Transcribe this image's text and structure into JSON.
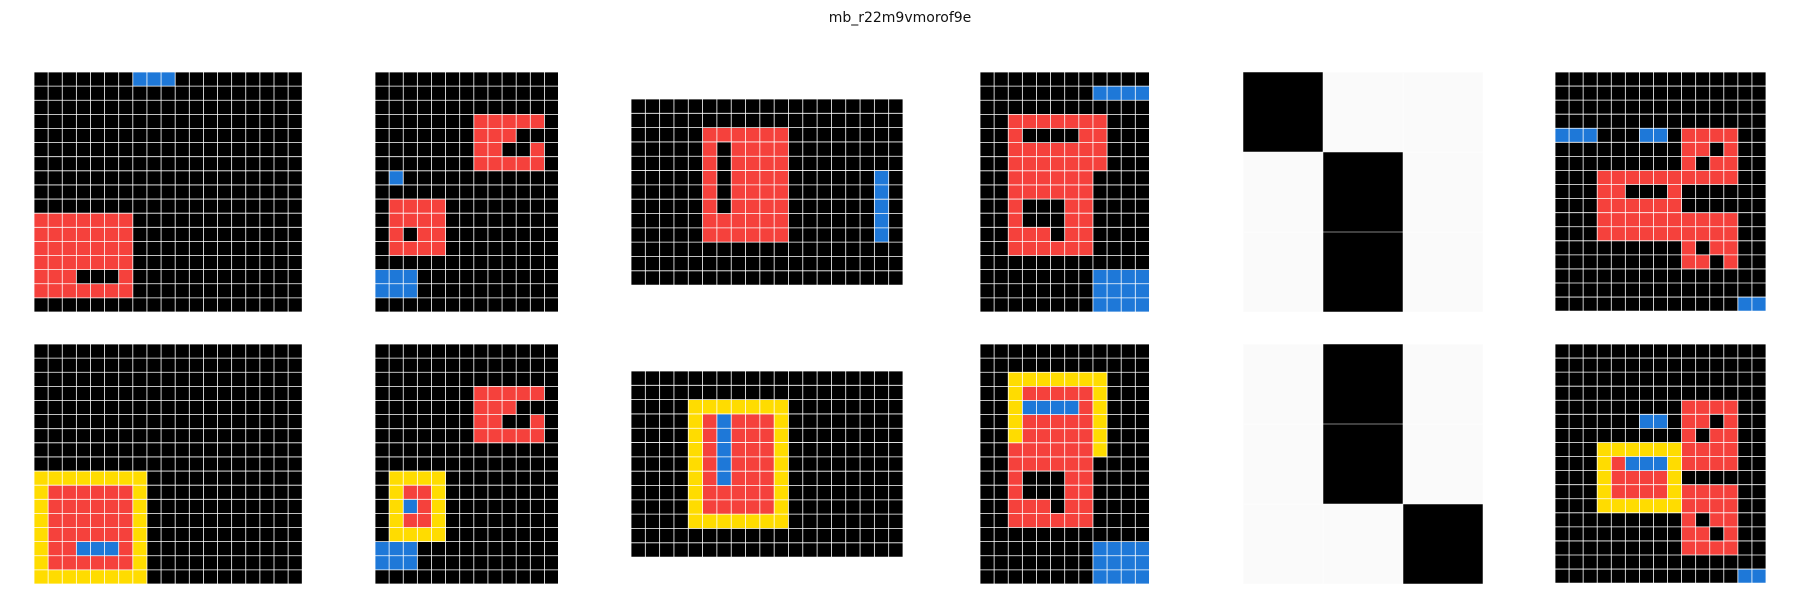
{
  "title": "mb_r22m9vmorof9e",
  "colors": {
    "0": "#000000",
    "1": "#1E78D8",
    "2": "#F5413C",
    "4": "#FFDC00",
    "9": "#FAFAFA",
    "grid_line": "#FFFFFF",
    "background": "#FFFFFF"
  },
  "pairs": [
    {
      "input": {
        "rows": 17,
        "cols": 19,
        "fills": [
          [
            0,
            7,
            0,
            9,
            1
          ],
          [
            10,
            0,
            15,
            6,
            2
          ],
          [
            14,
            3,
            14,
            5,
            0
          ]
        ]
      },
      "output": {
        "rows": 17,
        "cols": 19,
        "fills": [
          [
            9,
            0,
            16,
            7,
            4
          ],
          [
            10,
            1,
            15,
            6,
            2
          ],
          [
            14,
            3,
            14,
            5,
            1
          ]
        ]
      }
    },
    {
      "input": {
        "rows": 17,
        "cols": 13,
        "fills": [
          [
            3,
            7,
            6,
            11,
            2
          ],
          [
            4,
            10,
            4,
            11,
            0
          ],
          [
            5,
            9,
            5,
            10,
            0
          ],
          [
            7,
            1,
            7,
            1,
            1
          ],
          [
            9,
            1,
            12,
            4,
            2
          ],
          [
            11,
            2,
            11,
            2,
            0
          ],
          [
            14,
            0,
            15,
            2,
            1
          ]
        ]
      },
      "output": {
        "rows": 17,
        "cols": 13,
        "fills": [
          [
            3,
            7,
            6,
            11,
            2
          ],
          [
            4,
            10,
            4,
            11,
            0
          ],
          [
            5,
            9,
            5,
            10,
            0
          ],
          [
            9,
            1,
            13,
            4,
            4
          ],
          [
            10,
            2,
            12,
            3,
            2
          ],
          [
            11,
            2,
            11,
            2,
            1
          ],
          [
            14,
            0,
            15,
            2,
            1
          ]
        ]
      }
    },
    {
      "input": {
        "rows": 13,
        "cols": 19,
        "fills": [
          [
            2,
            5,
            9,
            10,
            2
          ],
          [
            3,
            6,
            7,
            6,
            0
          ],
          [
            5,
            17,
            9,
            17,
            1
          ]
        ]
      },
      "output": {
        "rows": 13,
        "cols": 19,
        "fills": [
          [
            2,
            4,
            10,
            10,
            4
          ],
          [
            3,
            5,
            9,
            9,
            2
          ],
          [
            3,
            6,
            7,
            6,
            1
          ]
        ]
      }
    },
    {
      "input": {
        "rows": 17,
        "cols": 12,
        "fills": [
          [
            1,
            8,
            1,
            11,
            1
          ],
          [
            3,
            2,
            6,
            8,
            2
          ],
          [
            4,
            3,
            4,
            6,
            0
          ],
          [
            7,
            2,
            12,
            7,
            2
          ],
          [
            9,
            3,
            10,
            5,
            0
          ],
          [
            11,
            5,
            11,
            5,
            0
          ],
          [
            14,
            8,
            16,
            11,
            1
          ]
        ]
      },
      "output": {
        "rows": 17,
        "cols": 12,
        "fills": [
          [
            3,
            2,
            6,
            8,
            2
          ],
          [
            3,
            2,
            3,
            5,
            1
          ],
          [
            4,
            3,
            4,
            6,
            0
          ],
          [
            2,
            2,
            7,
            8,
            4
          ],
          [
            3,
            3,
            6,
            7,
            2
          ],
          [
            4,
            3,
            4,
            6,
            1
          ],
          [
            7,
            2,
            12,
            7,
            2
          ],
          [
            9,
            3,
            10,
            5,
            0
          ],
          [
            11,
            5,
            11,
            5,
            0
          ],
          [
            14,
            8,
            16,
            11,
            1
          ]
        ]
      }
    },
    {
      "input": {
        "rows": 3,
        "cols": 3,
        "border": false,
        "fills": [
          [
            0,
            0,
            2,
            2,
            9
          ],
          [
            0,
            0,
            0,
            0,
            0
          ],
          [
            1,
            1,
            2,
            1,
            0
          ]
        ]
      },
      "output": {
        "rows": 3,
        "cols": 3,
        "border": false,
        "fills": [
          [
            0,
            0,
            2,
            2,
            9
          ],
          [
            0,
            1,
            1,
            1,
            0
          ],
          [
            2,
            2,
            2,
            2,
            0
          ]
        ]
      }
    },
    {
      "input": {
        "rows": 17,
        "cols": 15,
        "fills": [
          [
            4,
            0,
            4,
            2,
            1
          ],
          [
            4,
            6,
            4,
            7,
            1
          ],
          [
            4,
            9,
            7,
            12,
            2
          ],
          [
            5,
            11,
            5,
            11,
            0
          ],
          [
            6,
            10,
            6,
            10,
            0
          ],
          [
            7,
            3,
            11,
            8,
            2
          ],
          [
            8,
            5,
            8,
            7,
            0
          ],
          [
            10,
            9,
            13,
            12,
            2
          ],
          [
            12,
            10,
            12,
            10,
            0
          ],
          [
            13,
            11,
            13,
            11,
            0
          ],
          [
            16,
            13,
            16,
            14,
            1
          ]
        ]
      },
      "output": {
        "rows": 17,
        "cols": 15,
        "fills": [
          [
            5,
            6,
            5,
            7,
            1
          ],
          [
            4,
            9,
            8,
            12,
            2
          ],
          [
            5,
            11,
            5,
            11,
            0
          ],
          [
            6,
            10,
            6,
            10,
            0
          ],
          [
            7,
            3,
            11,
            8,
            4
          ],
          [
            8,
            4,
            10,
            7,
            2
          ],
          [
            8,
            5,
            8,
            7,
            1
          ],
          [
            10,
            9,
            14,
            12,
            2
          ],
          [
            12,
            10,
            12,
            10,
            0
          ],
          [
            13,
            11,
            13,
            11,
            0
          ],
          [
            16,
            13,
            16,
            14,
            1
          ]
        ]
      }
    }
  ]
}
